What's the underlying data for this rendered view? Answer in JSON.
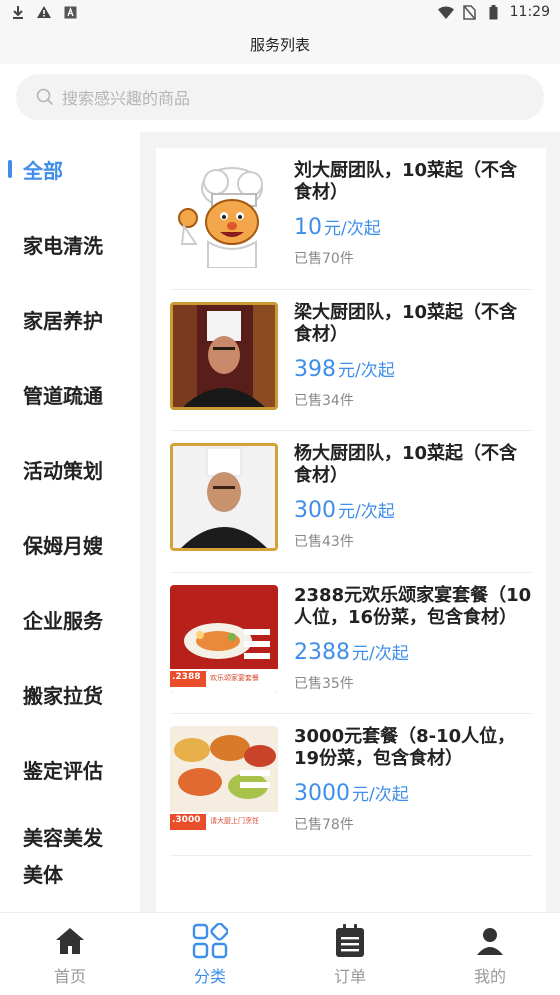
{
  "status_bar": {
    "time": "11:29",
    "left_icons": [
      "download-icon",
      "warning-icon",
      "app-icon"
    ],
    "right_icons": [
      "wifi-icon",
      "no-sim-icon",
      "battery-icon"
    ]
  },
  "header": {
    "title": "服务列表"
  },
  "search": {
    "placeholder": "搜索感兴趣的商品"
  },
  "sidebar": {
    "items": [
      {
        "label": "全部",
        "active": true
      },
      {
        "label": "家电清洗"
      },
      {
        "label": "家居养护"
      },
      {
        "label": "管道疏通"
      },
      {
        "label": "活动策划"
      },
      {
        "label": "保姆月嫂"
      },
      {
        "label": "企业服务"
      },
      {
        "label": "搬家拉货"
      },
      {
        "label": "鉴定评估"
      },
      {
        "label": "美容美发美体"
      }
    ]
  },
  "products": [
    {
      "title": "刘大厨团队，10菜起（不含食材）",
      "price": "10",
      "unit": "元/次起",
      "sold": "已售70件",
      "thumb": "chef-cartoon"
    },
    {
      "title": "梁大厨团队，10菜起（不含食材）",
      "price": "398",
      "unit": "元/次起",
      "sold": "已售34件",
      "thumb": "chef-photo"
    },
    {
      "title": "杨大厨团队，10菜起（不含食材）",
      "price": "300",
      "unit": "元/次起",
      "sold": "已售43件",
      "thumb": "chef-photo"
    },
    {
      "title": "2388元欢乐颂家宴套餐（10人位，16份菜，包含食材）",
      "price": "2388",
      "unit": "元/次起",
      "sold": "已售35件",
      "thumb": "banquet-photo",
      "thumb_tag": ".2388",
      "thumb_caption": "欢乐颂家宴套餐"
    },
    {
      "title": "3000元套餐（8-10人位，19份菜，包含食材）",
      "price": "3000",
      "unit": "元/次起",
      "sold": "已售78件",
      "thumb": "banquet-photo",
      "thumb_tag": ".3000",
      "thumb_caption": "请大厨上门烹饪"
    }
  ],
  "tabbar": {
    "items": [
      {
        "label": "首页",
        "icon": "home-icon"
      },
      {
        "label": "分类",
        "icon": "category-icon",
        "active": true
      },
      {
        "label": "订单",
        "icon": "order-icon"
      },
      {
        "label": "我的",
        "icon": "profile-icon"
      }
    ]
  },
  "colors": {
    "accent": "#3e8eea",
    "text": "#222222",
    "muted": "#8a8a8a",
    "background": "#f3f3f3"
  }
}
